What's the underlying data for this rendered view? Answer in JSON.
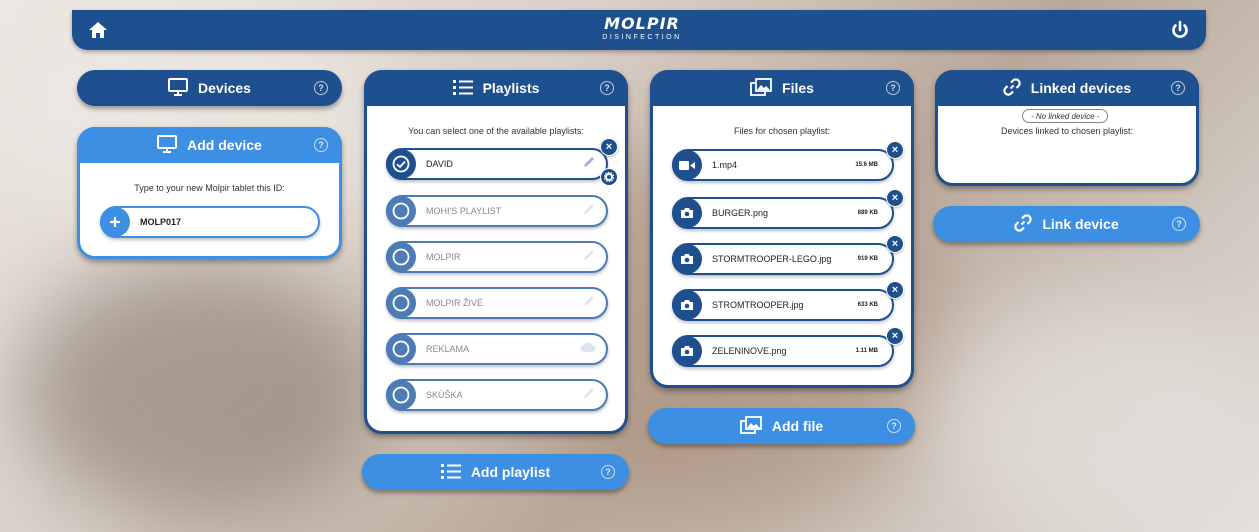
{
  "header": {
    "logo_word": "MOLPIR",
    "logo_sub": "DISINFECTION"
  },
  "devices": {
    "title": "Devices"
  },
  "add_device": {
    "title": "Add device",
    "caption": "Type to your new Molpir tablet this ID:",
    "device_id": "MOLP017"
  },
  "playlists": {
    "title": "Playlists",
    "caption": "You can select one of the available playlists:",
    "items": [
      {
        "label": "DAVID",
        "selected": true
      },
      {
        "label": "MOHI'S PLAYLIST",
        "selected": false
      },
      {
        "label": "MOLPIR",
        "selected": false
      },
      {
        "label": "MOLPIR ŽIVÉ",
        "selected": false
      },
      {
        "label": "REKLAMA",
        "selected": false
      },
      {
        "label": "SKÚŠKA",
        "selected": false
      }
    ],
    "add_label": "Add playlist"
  },
  "files": {
    "title": "Files",
    "caption": "Files for chosen playlist:",
    "items": [
      {
        "name": "1.mp4",
        "size": "15.6 MB",
        "icon": "video-icon"
      },
      {
        "name": "BURGER.png",
        "size": "889 KB",
        "icon": "camera-icon"
      },
      {
        "name": "STORMTROOPER-LEGO.jpg",
        "size": "919 KB",
        "icon": "camera-icon"
      },
      {
        "name": "STROMTROOPER.jpg",
        "size": "633 KB",
        "icon": "camera-icon"
      },
      {
        "name": "ZELENINOVE.png",
        "size": "1.11 MB",
        "icon": "camera-icon"
      }
    ],
    "add_label": "Add file"
  },
  "linked": {
    "title": "Linked devices",
    "caption": "Devices linked to chosen playlist:",
    "empty_label": "- No linked device -",
    "link_label": "Link device"
  },
  "help_symbol": "?",
  "close_symbol": "×",
  "colors": {
    "primary": "#1e4f8e",
    "accent": "#3d8fe3",
    "faded": "#4c7bb5"
  }
}
